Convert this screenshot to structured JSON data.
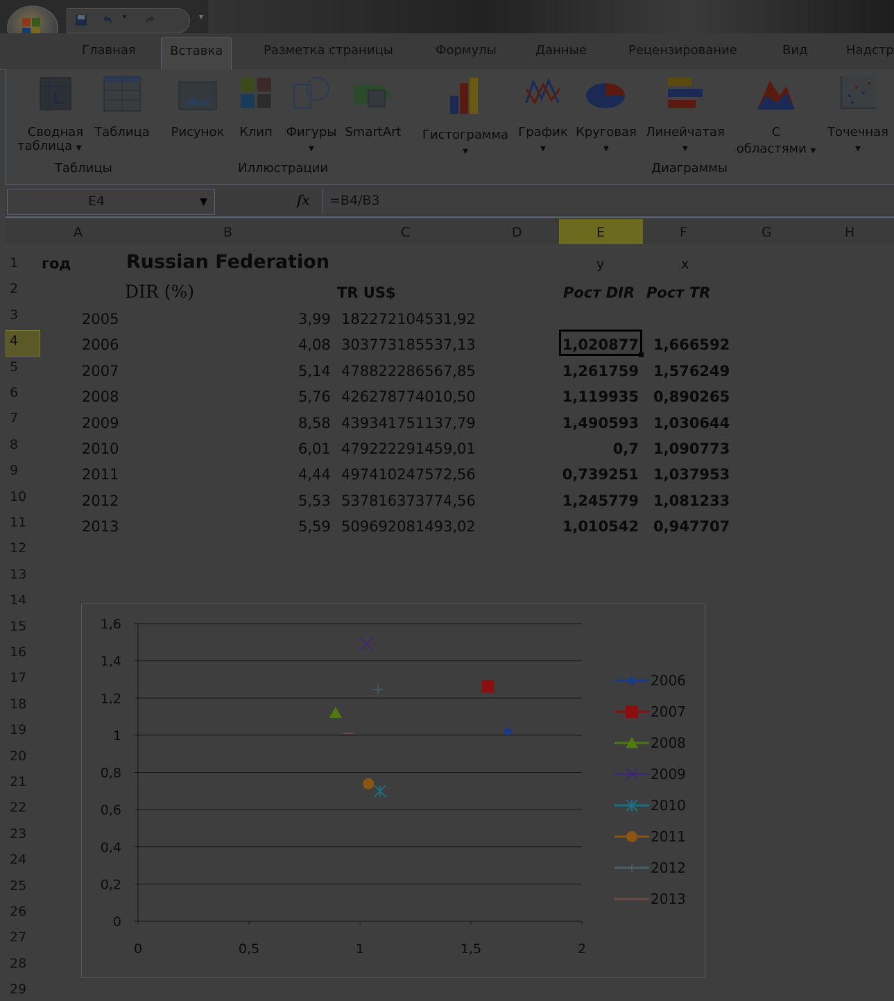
{
  "tabs": [
    "Главная",
    "Вставка",
    "Разметка страницы",
    "Формулы",
    "Данные",
    "Рецензирование",
    "Вид",
    "Надстр"
  ],
  "active_tab": "Вставка",
  "ribbon": {
    "pivot_label_1": "Сводная",
    "pivot_label_2": "таблица",
    "table_label": "Таблица",
    "picture_label": "Рисунок",
    "clip_label": "Клип",
    "shapes_label": "Фигуры",
    "smartart_label": "SmartArt",
    "histogram_label": "Гистограмма",
    "line_label": "График",
    "pie_label": "Круговая",
    "bar_label": "Линейчатая",
    "area_label_1": "С",
    "area_label_2": "областями",
    "scatter_label": "Точечная",
    "group_tables": "Таблицы",
    "group_illustrations": "Иллюстрации",
    "group_charts": "Диаграммы"
  },
  "formula_bar": {
    "name_box": "E4",
    "fx": "fx",
    "formula": "=B4/B3"
  },
  "columns": [
    "A",
    "B",
    "C",
    "D",
    "E",
    "F",
    "G",
    "H"
  ],
  "row_numbers": [
    "1",
    "2",
    "3",
    "4",
    "5",
    "6",
    "7",
    "8",
    "9",
    "10",
    "11",
    "12",
    "13",
    "14",
    "15",
    "16",
    "17",
    "18",
    "19",
    "20",
    "21",
    "22",
    "23",
    "24",
    "25",
    "26",
    "27",
    "28",
    "29"
  ],
  "sheet": {
    "a1": "год",
    "b1": "Russian Federation",
    "b2": "DIR (%)",
    "c2": "TR US$",
    "e1": "y",
    "f1": "x",
    "e2": "Рост DIR",
    "f2": "Рост TR",
    "rows": [
      {
        "year": "2005",
        "dir": "3,99",
        "tr": "182272104531,92",
        "y": "",
        "x": ""
      },
      {
        "year": "2006",
        "dir": "4,08",
        "tr": "303773185537,13",
        "y": "1,020877",
        "x": "1,666592"
      },
      {
        "year": "2007",
        "dir": "5,14",
        "tr": "478822286567,85",
        "y": "1,261759",
        "x": "1,576249"
      },
      {
        "year": "2008",
        "dir": "5,76",
        "tr": "426278774010,50",
        "y": "1,119935",
        "x": "0,890265"
      },
      {
        "year": "2009",
        "dir": "8,58",
        "tr": "439341751137,79",
        "y": "1,490593",
        "x": "1,030644"
      },
      {
        "year": "2010",
        "dir": "6,01",
        "tr": "479222291459,01",
        "y": "0,7",
        "x": "1,090773"
      },
      {
        "year": "2011",
        "dir": "4,44",
        "tr": "497410247572,56",
        "y": "0,739251",
        "x": "1,037953"
      },
      {
        "year": "2012",
        "dir": "5,53",
        "tr": "537816373774,56",
        "y": "1,245779",
        "x": "1,081233"
      },
      {
        "year": "2013",
        "dir": "5,59",
        "tr": "509692081493,02",
        "y": "1,010542",
        "x": "0,947707"
      }
    ]
  },
  "chart_data": {
    "type": "scatter",
    "xlim": [
      0,
      2
    ],
    "ylim": [
      0,
      1.6
    ],
    "x_ticks": [
      "0",
      "0,5",
      "1",
      "1,5",
      "2"
    ],
    "y_ticks": [
      "0",
      "0,2",
      "0,4",
      "0,6",
      "0,8",
      "1",
      "1,2",
      "1,4",
      "1,6"
    ],
    "grid": true,
    "legend_position": "right",
    "series": [
      {
        "name": "2006",
        "x": 1.666592,
        "y": 1.020877,
        "color": "#1a3a8a",
        "marker": "diamond"
      },
      {
        "name": "2007",
        "x": 1.576249,
        "y": 1.261759,
        "color": "#8a1010",
        "marker": "square"
      },
      {
        "name": "2008",
        "x": 0.890265,
        "y": 1.119935,
        "color": "#4e7a10",
        "marker": "triangle"
      },
      {
        "name": "2009",
        "x": 1.030644,
        "y": 1.490593,
        "color": "#3c2a70",
        "marker": "x"
      },
      {
        "name": "2010",
        "x": 1.090773,
        "y": 0.7,
        "color": "#1a6f80",
        "marker": "star"
      },
      {
        "name": "2011",
        "x": 1.037953,
        "y": 0.739251,
        "color": "#8a5412",
        "marker": "circle"
      },
      {
        "name": "2012",
        "x": 1.081233,
        "y": 1.245779,
        "color": "#46606a",
        "marker": "plus"
      },
      {
        "name": "2013",
        "x": 0.947707,
        "y": 1.010542,
        "color": "#6a4a48",
        "marker": "dash"
      }
    ]
  }
}
